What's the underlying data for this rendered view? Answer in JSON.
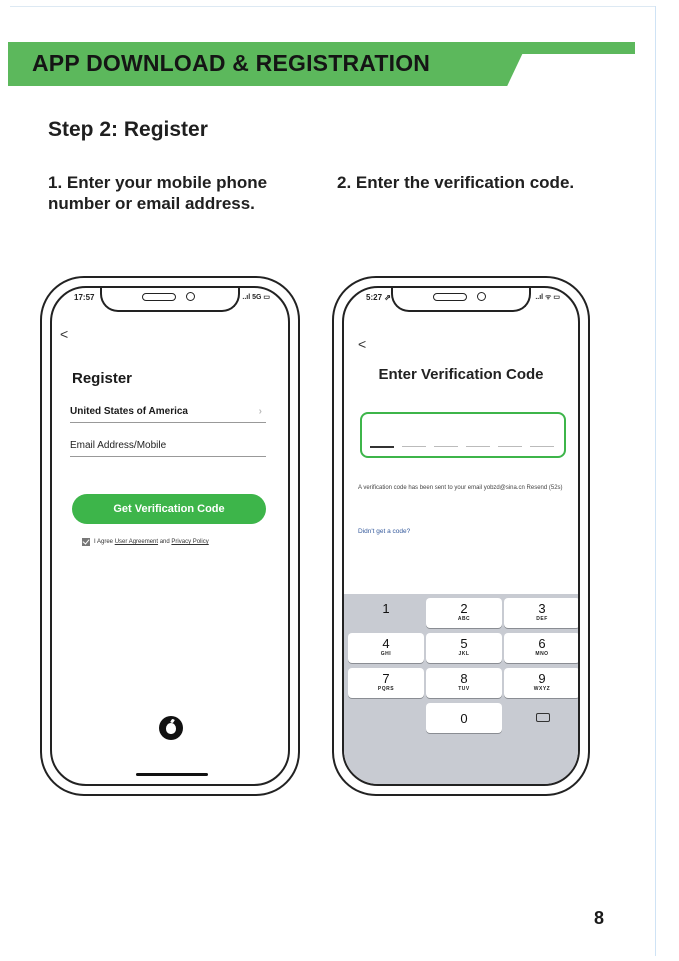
{
  "header": {
    "title": "APP DOWNLOAD & REGISTRATION",
    "accent_color": "#5cb85c"
  },
  "step": {
    "title": "Step 2: Register"
  },
  "instructions": {
    "first": "1. Enter your mobile phone number or email address.",
    "second": "2. Enter the verification code."
  },
  "left_phone": {
    "status_time": "17:57",
    "status_right": "..ıl 5G ▭",
    "back": "<",
    "title": "Register",
    "country": "United States of America",
    "email_placeholder": "Email Address/Mobile",
    "button_label": "Get Verification Code",
    "button_color": "#3db54a",
    "agree_prefix": "I Agree",
    "agree_link_1": "User Agreement",
    "agree_mid": "and",
    "agree_link_2": "Privacy Policy",
    "social_icon": "apple-icon"
  },
  "right_phone": {
    "status_time": "5:27 ⇗",
    "status_right": "..ıl ᯤ ▭",
    "back": "<",
    "title": "Enter Verification Code",
    "sent_message": "A verification code has been sent to your email yobzd@sina.cn  Resend (52s)",
    "didnt_get": "Didn't get a code?",
    "keys": [
      {
        "digit": "1",
        "letters": ""
      },
      {
        "digit": "2",
        "letters": "ABC"
      },
      {
        "digit": "3",
        "letters": "DEF"
      },
      {
        "digit": "4",
        "letters": "GHI"
      },
      {
        "digit": "5",
        "letters": "JKL"
      },
      {
        "digit": "6",
        "letters": "MNO"
      },
      {
        "digit": "7",
        "letters": "PQRS"
      },
      {
        "digit": "8",
        "letters": "TUV"
      },
      {
        "digit": "9",
        "letters": "WXYZ"
      },
      {
        "digit": "0",
        "letters": ""
      }
    ]
  },
  "page": {
    "number": "8"
  }
}
